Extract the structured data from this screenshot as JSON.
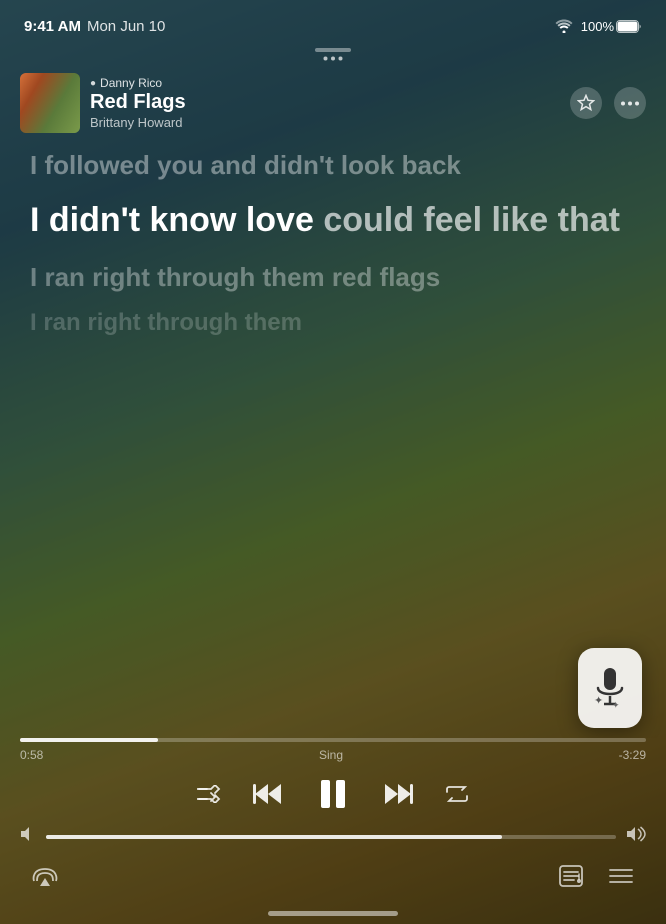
{
  "statusBar": {
    "time": "9:41 AM",
    "date": "Mon Jun 10",
    "wifi": "100%"
  },
  "nowPlaying": {
    "djLabel": "Danny Rico",
    "trackTitle": "Red Flags",
    "artist": "Brittany Howard"
  },
  "lyrics": {
    "past": "I followed you and didn't look back",
    "currentBold": "I didn't know love",
    "currentLight": "could feel like that",
    "future1": "I ran right through them red flags",
    "future2": "I ran right through them"
  },
  "progress": {
    "elapsed": "0:58",
    "label": "Sing",
    "remaining": "-3:29",
    "percent": 22
  },
  "volume": {
    "level": 80
  },
  "controls": {
    "shuffle": "⇄",
    "rewind": "⏮",
    "pause": "⏸",
    "forward": "⏭",
    "repeat": "↻"
  },
  "header": {
    "starLabel": "★",
    "moreLabel": "•••"
  },
  "bottomBar": {
    "airplayIcon": "airplay",
    "lyricsIcon": "lyrics",
    "listIcon": "list"
  }
}
